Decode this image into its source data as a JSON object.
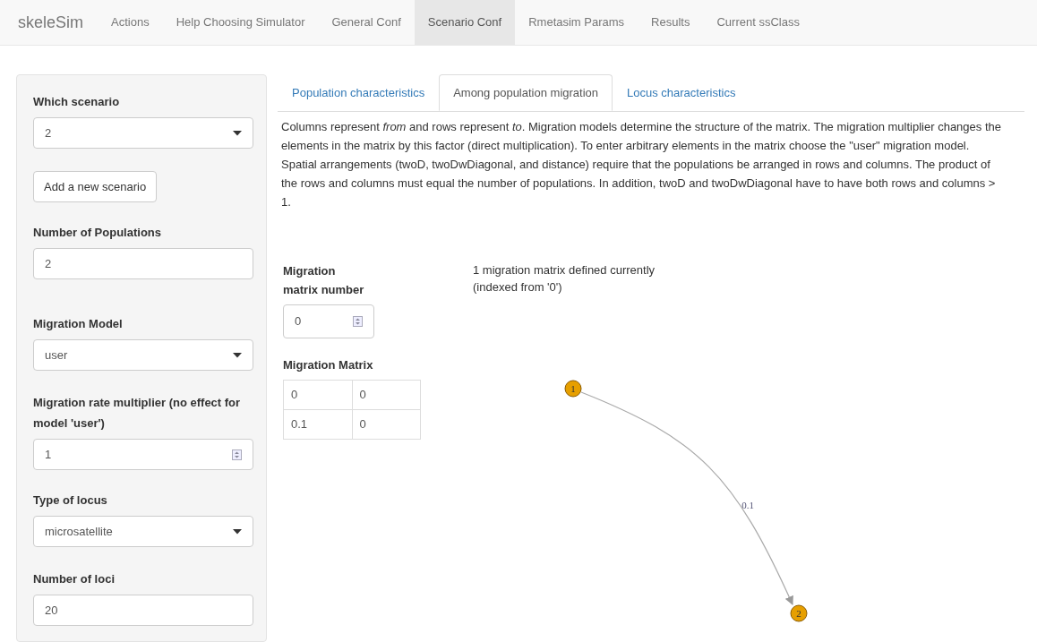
{
  "navbar": {
    "brand": "skeleSim",
    "items": [
      {
        "label": "Actions",
        "selected": false
      },
      {
        "label": "Help Choosing Simulator",
        "selected": false
      },
      {
        "label": "General Conf",
        "selected": false
      },
      {
        "label": "Scenario Conf",
        "selected": true
      },
      {
        "label": "Rmetasim Params",
        "selected": false
      },
      {
        "label": "Results",
        "selected": false
      },
      {
        "label": "Current ssClass",
        "selected": false
      }
    ]
  },
  "sidebar": {
    "controls": [
      {
        "kind": "select",
        "label": "Which scenario",
        "value": "2"
      },
      {
        "kind": "button",
        "label": "Add a new scenario"
      },
      {
        "kind": "text",
        "label": "Number of Populations",
        "value": "2"
      },
      {
        "kind": "select",
        "label": "Migration Model",
        "value": "user"
      },
      {
        "kind": "number",
        "label": "Migration rate multiplier (no effect for model 'user')",
        "value": "1"
      },
      {
        "kind": "select",
        "label": "Type of locus",
        "value": "microsatellite"
      },
      {
        "kind": "text",
        "label": "Number of loci",
        "value": "20"
      }
    ]
  },
  "tabs": [
    {
      "label": "Population characteristics",
      "selected": false
    },
    {
      "label": "Among population migration",
      "selected": true
    },
    {
      "label": "Locus characteristics",
      "selected": false
    }
  ],
  "description": "Columns represent *from* and rows represent *to*. Migration models determine the structure of the matrix. The migration multiplier changes the elements in the matrix by this factor (direct multiplication). To enter arbitrary elements in the matrix choose the \"user\" migration model. Spatial arrangements (twoD, twoDwDiagonal, and distance) require that the populations be arranged in rows and columns. The product of the rows and columns must equal the number of populations. In addition, twoD and twoDwDiagonal have to have both rows and columns > 1.",
  "matrix_number": {
    "label": "Migration matrix number",
    "value": "0"
  },
  "matrix_info": [
    "1 migration matrix defined currently",
    "(indexed from '0')"
  ],
  "matrix": {
    "title": "Migration Matrix",
    "rows": [
      [
        "0",
        "0"
      ],
      [
        "0.1",
        "0"
      ]
    ]
  },
  "graph": {
    "nodes": [
      {
        "label": "1"
      },
      {
        "label": "2"
      }
    ],
    "edges": [
      {
        "label": "0.1"
      }
    ]
  }
}
